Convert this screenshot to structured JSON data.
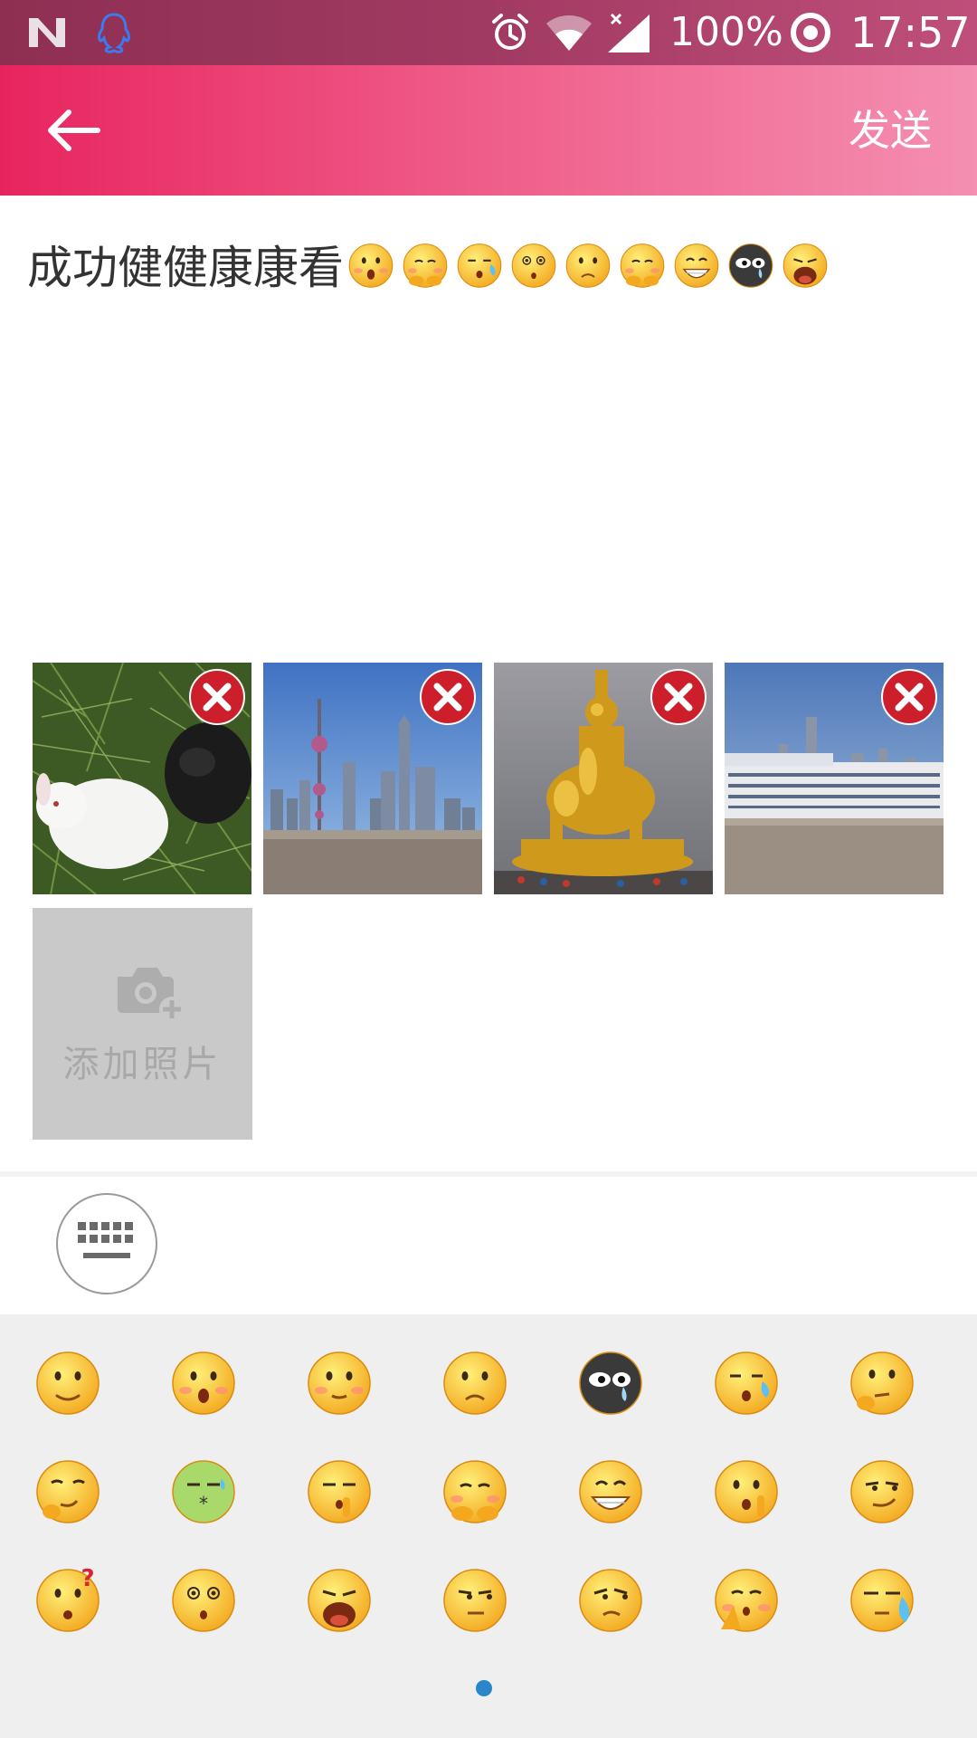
{
  "status_bar": {
    "notification_icons": [
      "n-icon",
      "qq-icon"
    ],
    "system_icons": [
      "alarm-icon",
      "wifi-icon",
      "signal-icon"
    ],
    "battery": "100%",
    "time": "17:57"
  },
  "app_bar": {
    "back_icon": "arrow-left-icon",
    "send_label": "发送"
  },
  "compose": {
    "text": "成功健健康康看",
    "inline_emojis": [
      "surprised",
      "shy",
      "sleepy-sweat",
      "dizzy",
      "frown",
      "shy",
      "grin",
      "black-crying",
      "wail"
    ]
  },
  "photos": [
    {
      "name": "rabbits-on-grass",
      "remove_icon": "close-icon"
    },
    {
      "name": "shanghai-skyline",
      "remove_icon": "close-icon"
    },
    {
      "name": "golden-buddha-statue",
      "remove_icon": "close-icon"
    },
    {
      "name": "cruise-ship-skyline",
      "remove_icon": "close-icon"
    }
  ],
  "add_photo": {
    "icon": "camera-add-icon",
    "label": "添加照片"
  },
  "toolbar": {
    "keyboard_icon": "keyboard-icon"
  },
  "emoji_panel": {
    "rows": [
      [
        "smile",
        "surprised-blush",
        "blush-smile",
        "frown",
        "black-crying",
        "sleepy-sweat",
        "thinking"
      ],
      [
        "smirk-think",
        "sick-sweat",
        "shush",
        "shy",
        "grin",
        "hush",
        "smug"
      ],
      [
        "question",
        "dizzy",
        "wail",
        "side-eye",
        "disdain",
        "pray",
        "cold-sweat"
      ]
    ],
    "page_indicator": {
      "current": 1,
      "total": 1
    }
  }
}
